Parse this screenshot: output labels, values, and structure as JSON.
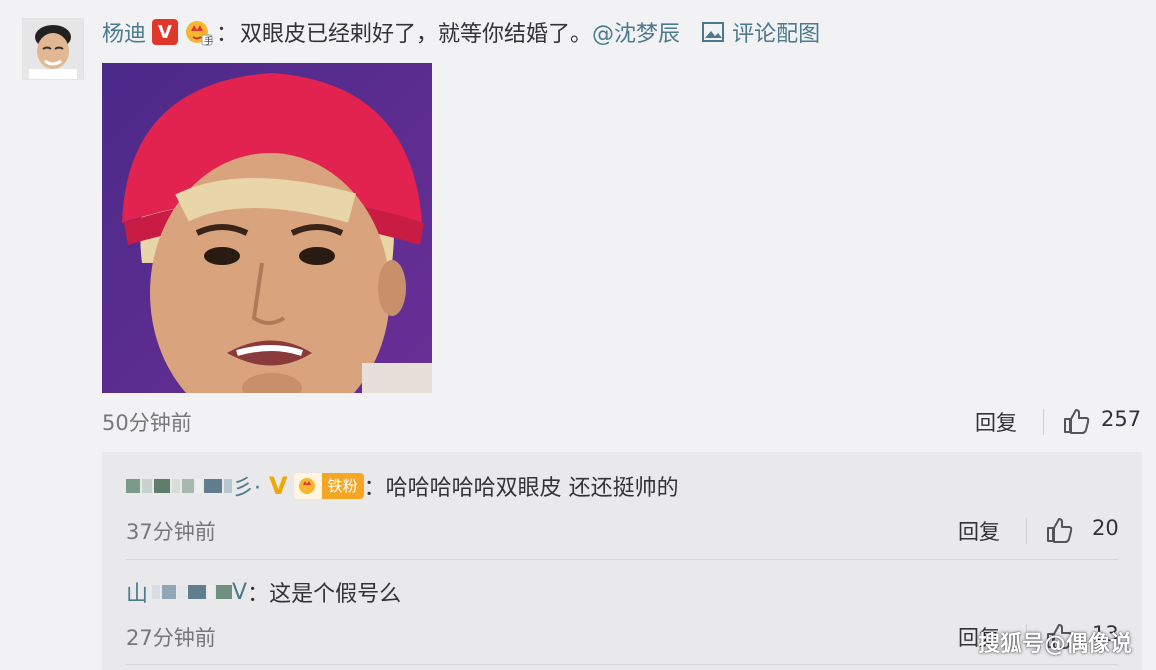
{
  "main_comment": {
    "username": "杨迪",
    "colon": "：",
    "text": "双眼皮已经剌好了，就等你结婚了。",
    "mention": "@沈梦辰",
    "pic_link_label": "评论配图",
    "time": "50分钟前",
    "reply_label": "回复",
    "likes": "257",
    "verified_badge": "V"
  },
  "replies": [
    {
      "username_tail": "彡·",
      "badge": "V",
      "fan_badge": "铁粉",
      "colon": "：",
      "text": "哈哈哈哈哈双眼皮 还还挺帅的",
      "time": "37分钟前",
      "reply_label": "回复",
      "likes": "20"
    },
    {
      "username_head": "山",
      "username_tail": "V",
      "colon": "：",
      "text": "这是个假号么",
      "time": "27分钟前",
      "reply_label": "回复",
      "likes": "13"
    }
  ],
  "watermark": "搜狐号@偶像说",
  "colors": {
    "link": "#4a7a8c",
    "badge_red": "#e0372d",
    "badge_gold": "#f5a623"
  },
  "icons": [
    "avatar",
    "crown-icon",
    "image-icon",
    "like-icon",
    "fan-icon"
  ]
}
